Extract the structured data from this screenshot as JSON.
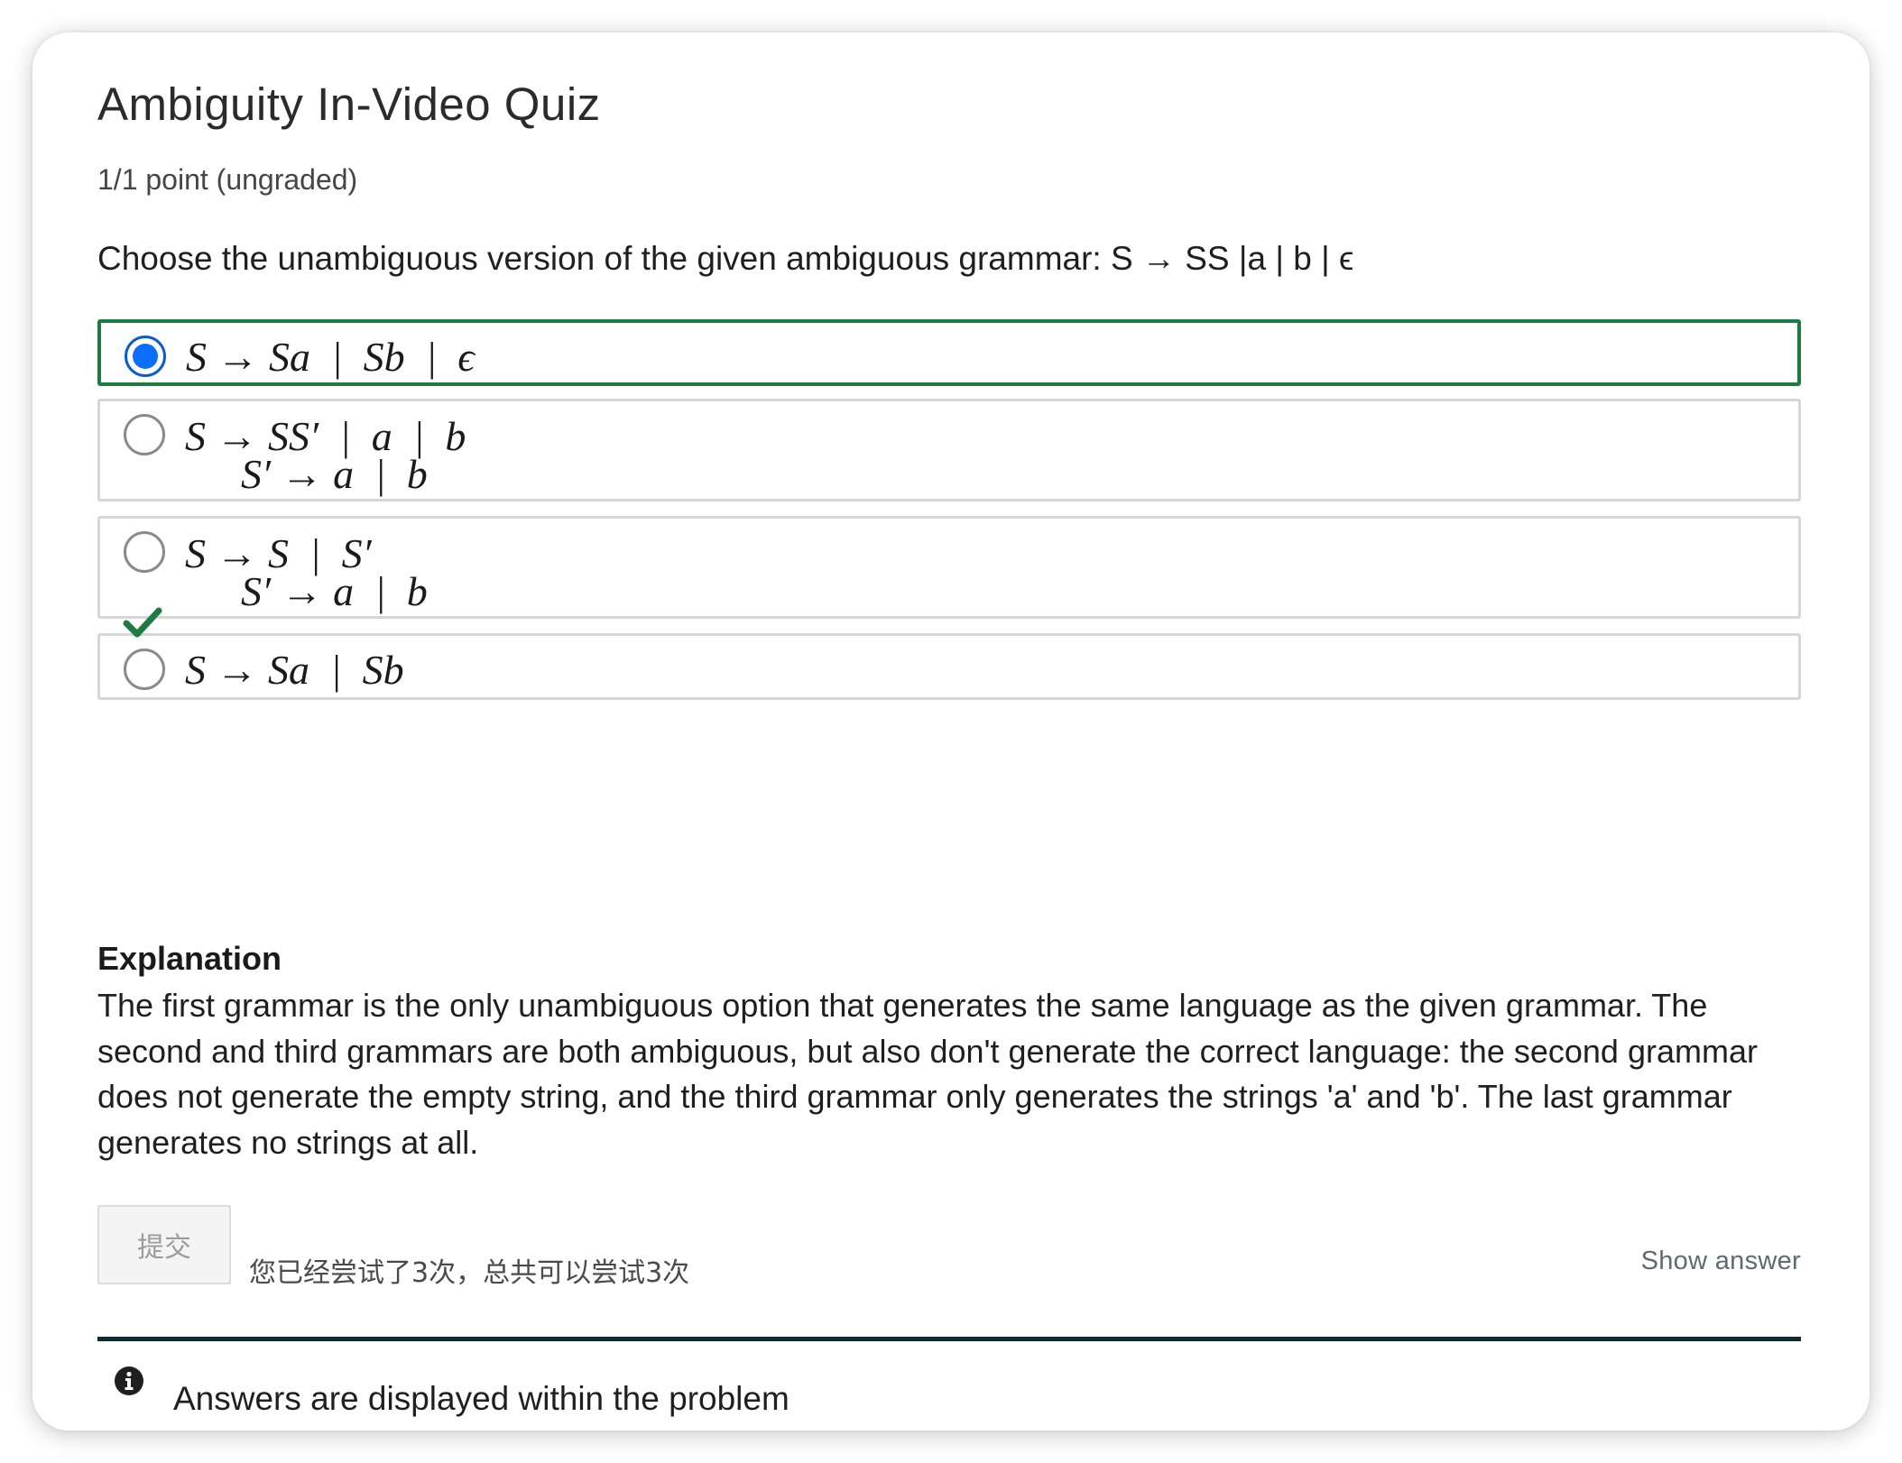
{
  "problem": {
    "title": "Ambiguity In-Video Quiz",
    "points": "1/1 point (ungraded)",
    "question": "Choose the unambiguous version of the given ambiguous grammar: S → SS |a | b | ϵ"
  },
  "options": [
    {
      "line1": "S → Sa  |  Sb  |  ϵ",
      "line2": "",
      "selected": true
    },
    {
      "line1": "S → SS′  |  a  |  b",
      "line2": "S′ → a  |  b",
      "selected": false
    },
    {
      "line1": "S → S  |  S′",
      "line2": "S′ → a  |  b",
      "selected": false
    },
    {
      "line1": "S → Sa  |  Sb",
      "line2": "",
      "selected": false
    }
  ],
  "explanation": {
    "heading": "Explanation",
    "text": "The first grammar is the only unambiguous option that generates the same language as the given grammar. The second and third grammars are both ambiguous, but also don't generate the correct language: the second grammar does not generate the empty string, and the third grammar only generates the strings 'a' and 'b'. The last grammar generates no strings at all."
  },
  "actions": {
    "submit_label": "提交",
    "attempts_text": "您已经尝试了3次，总共可以尝试3次",
    "show_answer_label": "Show answer"
  },
  "notice": {
    "text": "Answers are displayed within the problem",
    "icon": "info-icon"
  },
  "colors": {
    "correct": "#1f7a43",
    "radio_selected": "#0d6efd",
    "divider": "#0e2a2f"
  }
}
